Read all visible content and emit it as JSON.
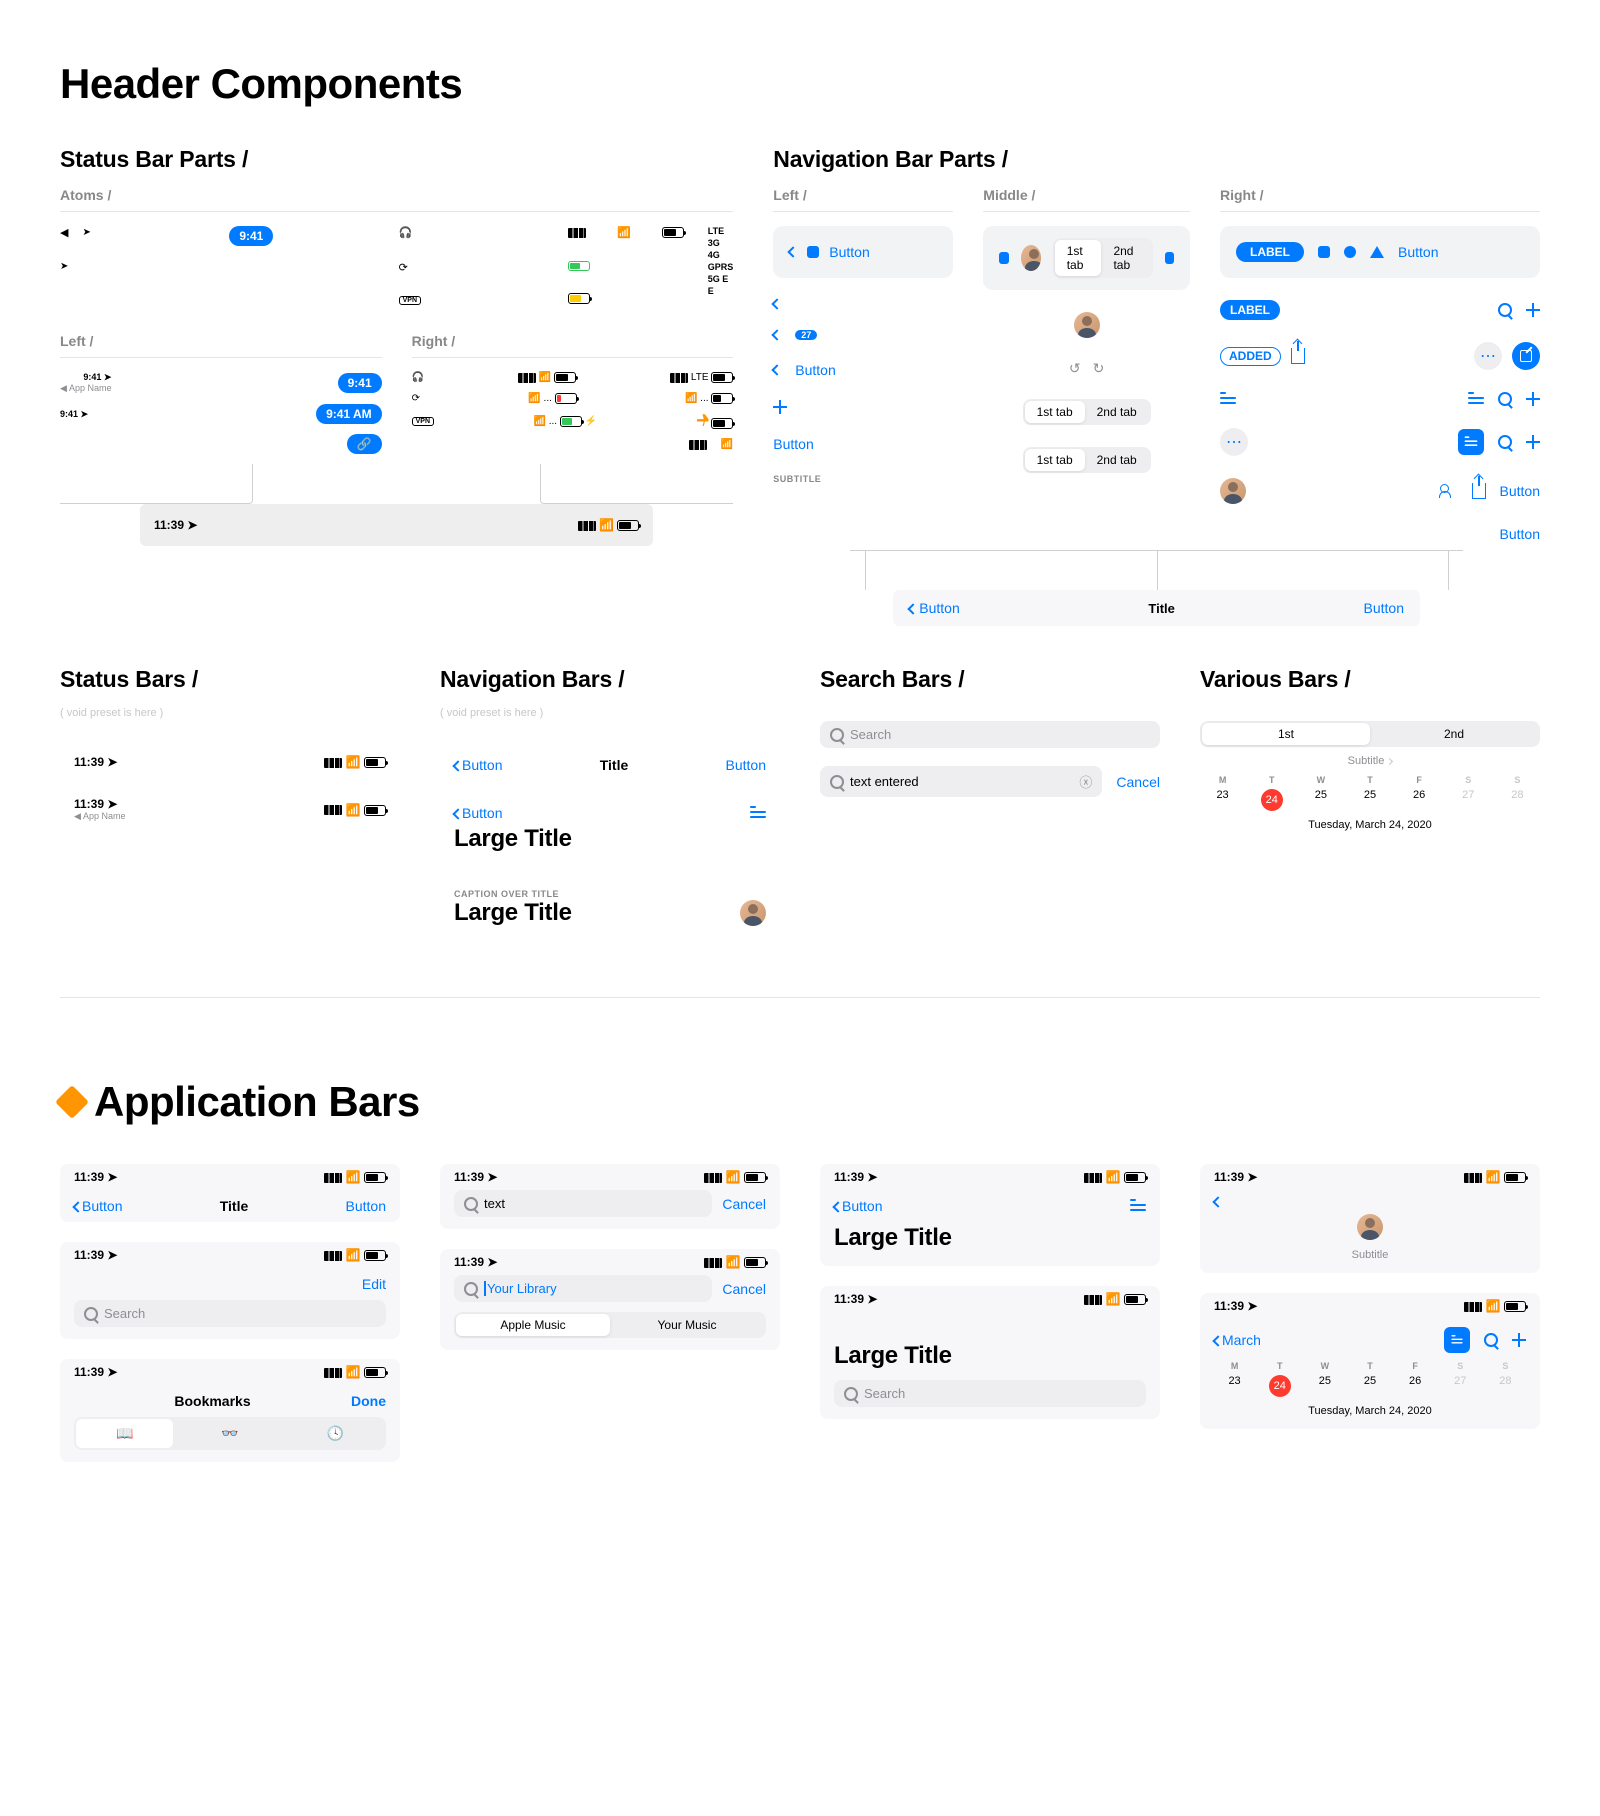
{
  "titles": {
    "page": "Header Components",
    "app_bars": "Application Bars",
    "status_parts": "Status Bar Parts /",
    "nav_parts": "Navigation Bar Parts /",
    "atoms": "Atoms /",
    "left": "Left /",
    "right": "Right /",
    "middle": "Middle /",
    "status_bars": "Status Bars /",
    "nav_bars": "Navigation Bars /",
    "search_bars": "Search Bars /",
    "various_bars": "Various Bars /"
  },
  "common": {
    "button": "Button",
    "title": "Title",
    "subtitle": "SUBTITLE",
    "large_title": "Large Title",
    "caption": "CAPTION OVER TITLE",
    "void": "( void preset is here )",
    "label": "LABEL",
    "added": "ADDED",
    "cancel": "Cancel",
    "edit": "Edit",
    "done": "Done",
    "search": "Search",
    "text_entered": "text entered",
    "text": "text",
    "your_library": "Your Library",
    "bookmarks": "Bookmarks",
    "subtitle_txt": "Subtitle",
    "march": "March"
  },
  "times": {
    "t941": "9:41",
    "t941am": "9:41 AM",
    "t1139": "11:39"
  },
  "status_atoms": {
    "app_name": "App Name",
    "net": [
      "LTE",
      "3G",
      "4G",
      "GPRS",
      "5G E",
      "E"
    ],
    "vpn": "VPN"
  },
  "tabs": {
    "first": "1st tab",
    "second": "2nd tab",
    "f": "1st",
    "s": "2nd",
    "apple": "Apple Music",
    "your": "Your Music"
  },
  "calendar": {
    "headers": [
      "M",
      "T",
      "W",
      "T",
      "F",
      "S",
      "S"
    ],
    "days": [
      "23",
      "24",
      "25",
      "25",
      "25",
      "26",
      "27",
      "28"
    ],
    "row": [
      "23",
      "24",
      "25",
      "25",
      "26",
      "27",
      "28"
    ],
    "date": "Tuesday, March 24, 2020"
  },
  "appbars": {
    "row1": [
      "23",
      "24",
      "25",
      "25",
      "26",
      "27",
      "28"
    ]
  }
}
